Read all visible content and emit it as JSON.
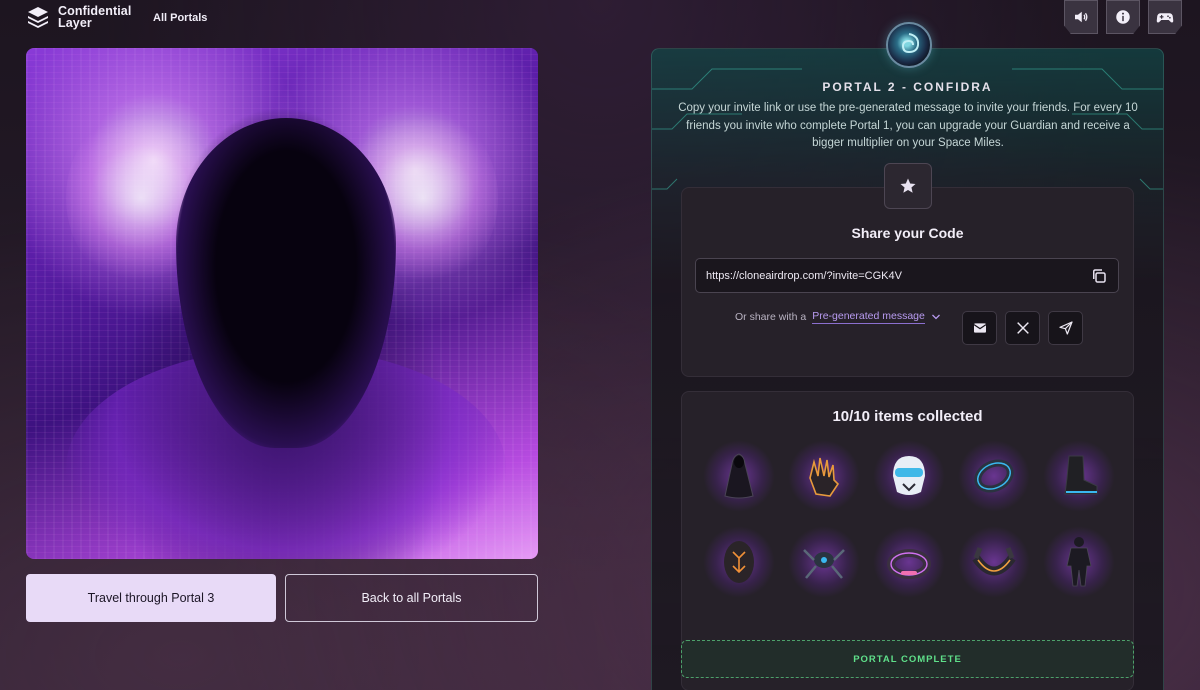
{
  "header": {
    "logo_line1": "Confidential",
    "logo_line2": "Layer",
    "nav_all_portals": "All Portals",
    "buttons": [
      {
        "icon": "speaker-icon"
      },
      {
        "icon": "info-icon"
      },
      {
        "icon": "gamepad-icon"
      }
    ]
  },
  "left": {
    "travel_label": "Travel through Portal 3",
    "back_label": "Back to all Portals"
  },
  "portal": {
    "title": "PORTAL 2 - CONFIDRA",
    "description": "Copy your invite link or use the pre-generated message to invite your friends. For every 10 friends you invite who complete Portal 1, you can upgrade your Guardian and receive a bigger multiplier on your Space Miles.",
    "share_title": "Share your Code",
    "invite_link": "https://cloneairdrop.com/?invite=CGK4V",
    "share_with_label": "Or share with a",
    "pregen_label": "Pre-generated message",
    "items_title": "10/10 items collected",
    "items": [
      {
        "name": "cloak"
      },
      {
        "name": "gauntlet"
      },
      {
        "name": "helmet"
      },
      {
        "name": "ring"
      },
      {
        "name": "boot"
      },
      {
        "name": "shield"
      },
      {
        "name": "drone"
      },
      {
        "name": "bracelet"
      },
      {
        "name": "collar"
      },
      {
        "name": "suit"
      }
    ],
    "complete_label": "PORTAL COMPLETE"
  },
  "colors": {
    "accent_purple": "#b89bf0",
    "complete_green": "#5fe08a",
    "travel_bg": "#e8daf7"
  }
}
